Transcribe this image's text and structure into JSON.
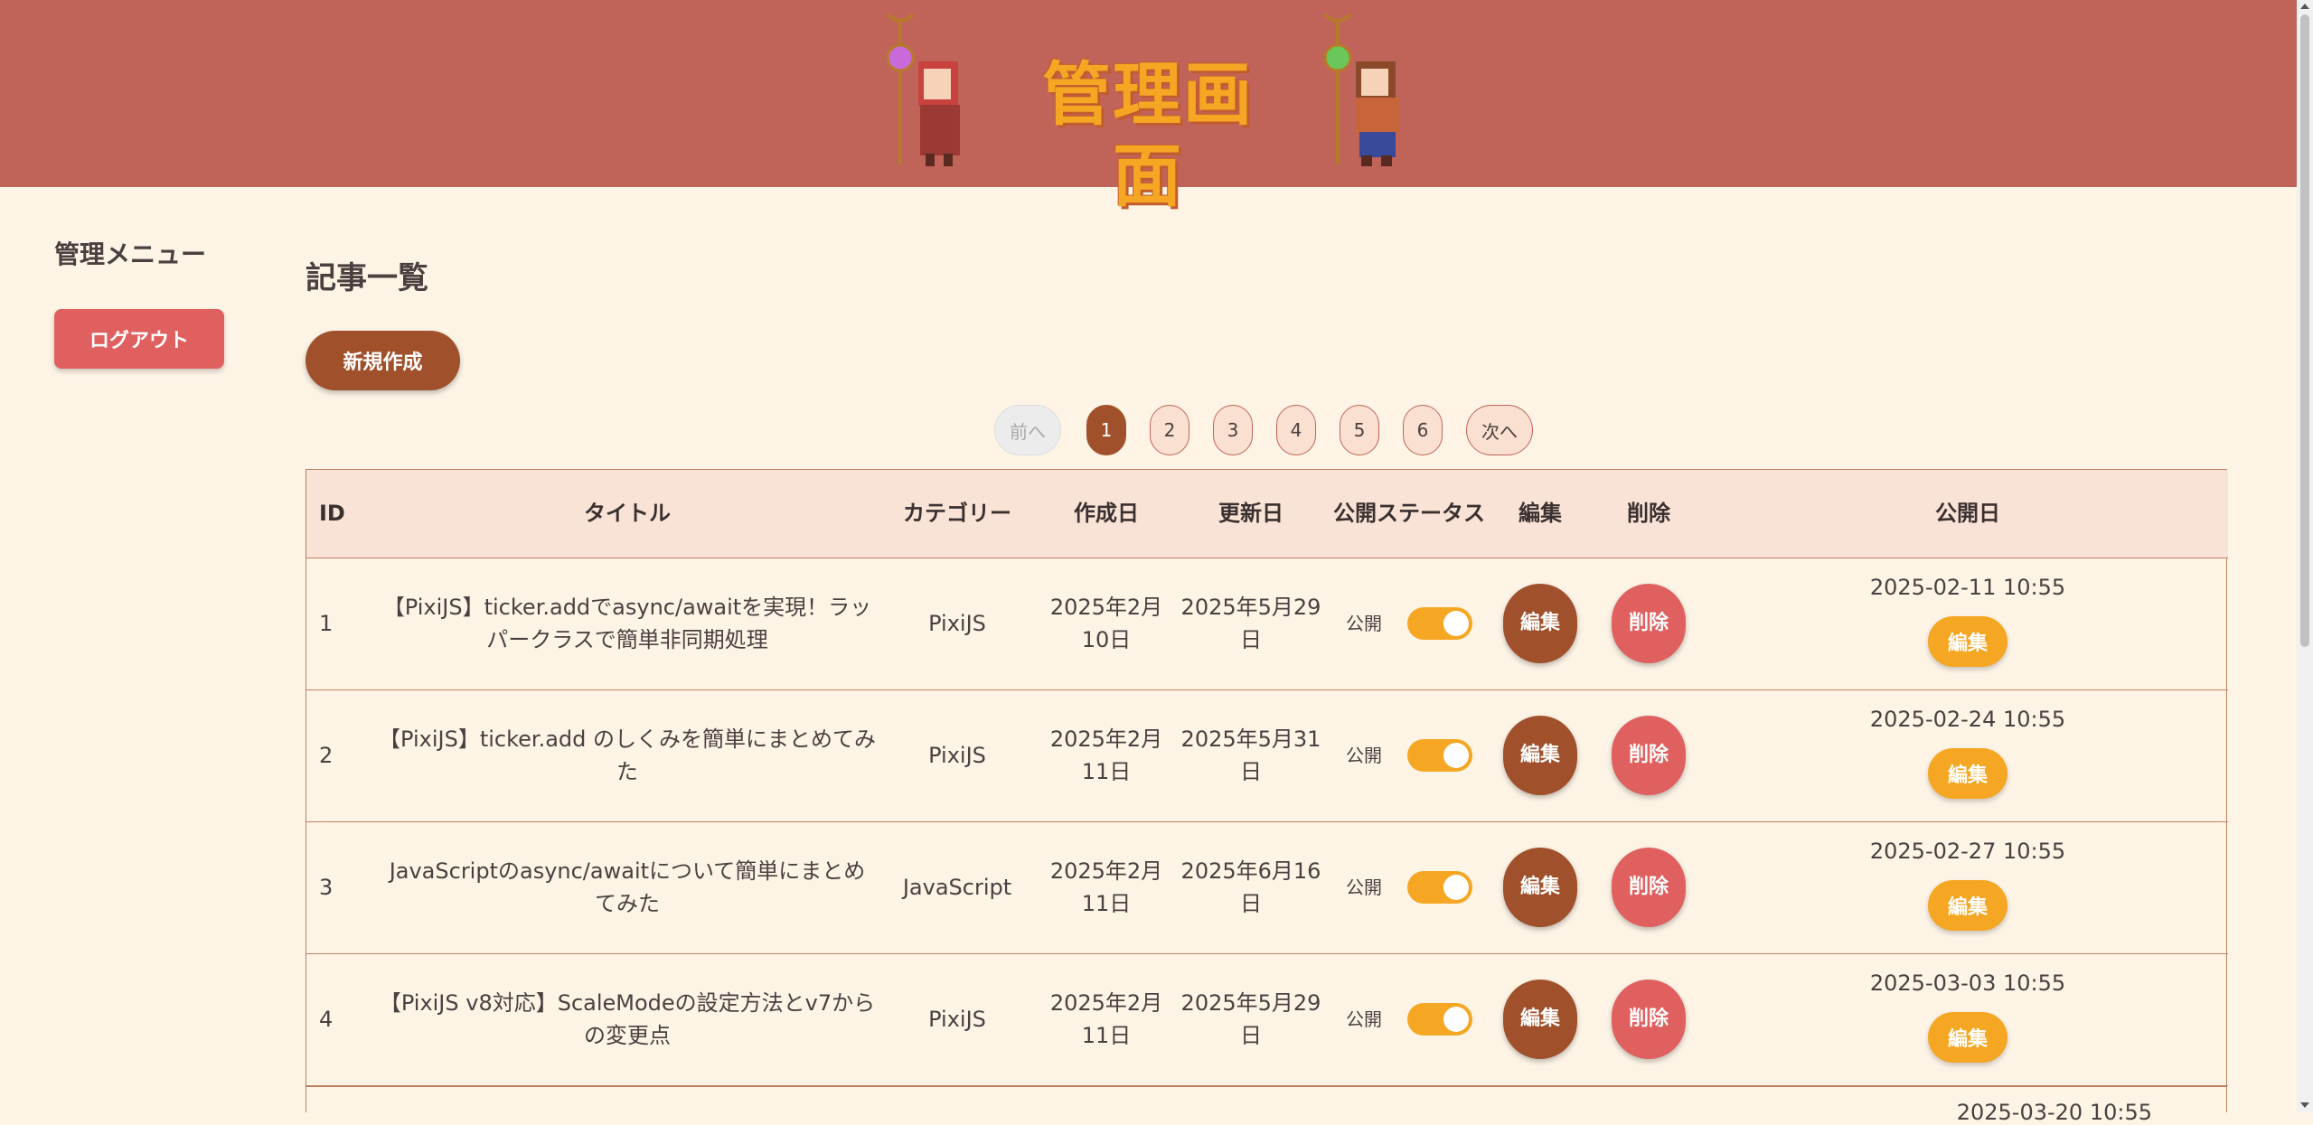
{
  "header": {
    "title": "管理画面",
    "left_character": "mage-girl-with-pink-orb-staff",
    "right_character": "mage-boy-with-green-orb-staff"
  },
  "sidebar": {
    "title": "管理メニュー",
    "logout_label": "ログアウト"
  },
  "main": {
    "page_title": "記事一覧",
    "new_button_label": "新規作成"
  },
  "pagination": {
    "prev_label": "前へ",
    "next_label": "次へ",
    "pages": [
      "1",
      "2",
      "3",
      "4",
      "5",
      "6"
    ],
    "active_page": "1"
  },
  "table": {
    "headers": {
      "id": "ID",
      "title": "タイトル",
      "category": "カテゴリー",
      "created": "作成日",
      "updated": "更新日",
      "status": "公開ステータス",
      "edit": "編集",
      "delete": "削除",
      "published": "公開日"
    },
    "rows": [
      {
        "id": "1",
        "title": "【PixiJS】ticker.addでasync/awaitを実現！ラッパークラスで簡単非同期処理",
        "category": "PixiJS",
        "created": "2025年2月10日",
        "updated": "2025年5月29日",
        "status": "公開",
        "edit_label": "編集",
        "delete_label": "削除",
        "published": "2025-02-11 10:55",
        "pub_edit_label": "編集"
      },
      {
        "id": "2",
        "title": "【PixiJS】ticker.add のしくみを簡単にまとめてみた",
        "category": "PixiJS",
        "created": "2025年2月11日",
        "updated": "2025年5月31日",
        "status": "公開",
        "edit_label": "編集",
        "delete_label": "削除",
        "published": "2025-02-24 10:55",
        "pub_edit_label": "編集"
      },
      {
        "id": "3",
        "title": "JavaScriptのasync/awaitについて簡単にまとめてみた",
        "category": "JavaScript",
        "created": "2025年2月11日",
        "updated": "2025年6月16日",
        "status": "公開",
        "edit_label": "編集",
        "delete_label": "削除",
        "published": "2025-02-27 10:55",
        "pub_edit_label": "編集"
      },
      {
        "id": "4",
        "title": "【PixiJS v8対応】ScaleModeの設定方法とv7からの変更点",
        "category": "PixiJS",
        "created": "2025年2月11日",
        "updated": "2025年5月29日",
        "status": "公開",
        "edit_label": "編集",
        "delete_label": "削除",
        "published": "2025-03-03 10:55",
        "pub_edit_label": "編集"
      }
    ],
    "partial_row_published": "2025-03-20 10:55"
  },
  "colors": {
    "header_bg": "#c0645a",
    "page_bg": "#fdf4e6",
    "accent_brown": "#a0512c",
    "accent_red": "#e06060",
    "accent_orange": "#f5a623"
  }
}
